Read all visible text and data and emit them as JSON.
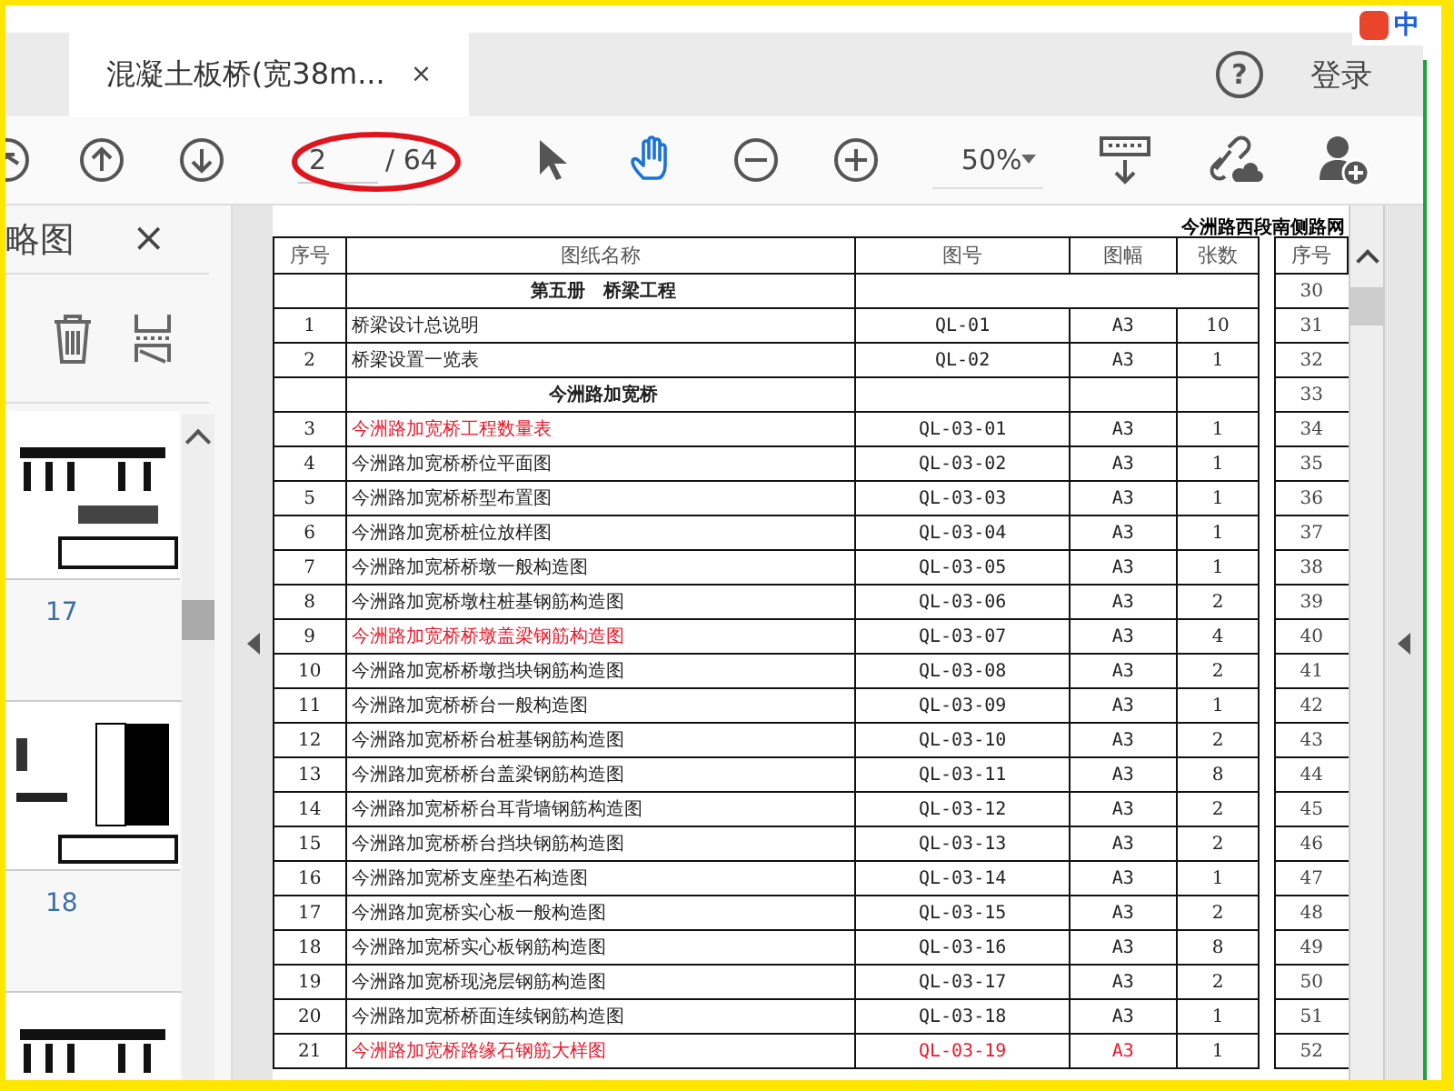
{
  "ime": {
    "label": "中"
  },
  "tab": {
    "title": "混凝土板桥(宽38m...",
    "close": "×"
  },
  "header_actions": {
    "help": "?",
    "login": "登录"
  },
  "toolbar": {
    "page_current": "2",
    "page_total": "/ 64",
    "zoom": "50%",
    "tools": [
      {
        "kind": "select",
        "selected": false
      },
      {
        "kind": "hand",
        "selected": true
      }
    ]
  },
  "thumbnails_panel": {
    "title": "略图",
    "close": "×",
    "pages": [
      {
        "label": "17"
      },
      {
        "label": "18"
      }
    ]
  },
  "document": {
    "page_header": "今洲路西段南侧路网",
    "columns": [
      "序号",
      "图纸名称",
      "图号",
      "图幅",
      "张数"
    ],
    "side_column": "序号",
    "rows": [
      {
        "kind": "volume",
        "title": "第五册　桥梁工程",
        "side": "30"
      },
      {
        "kind": "item",
        "no": "1",
        "name": "桥梁设计总说明",
        "code": "QL-01",
        "size": "A3",
        "sheets": "10",
        "name_flagged": false,
        "code_flagged": false,
        "side": "31"
      },
      {
        "kind": "item",
        "no": "2",
        "name": "桥梁设置一览表",
        "code": "QL-02",
        "size": "A3",
        "sheets": "1",
        "name_flagged": false,
        "code_flagged": false,
        "side": "32"
      },
      {
        "kind": "section",
        "title": "今洲路加宽桥",
        "side": "33"
      },
      {
        "kind": "item",
        "no": "3",
        "name": "今洲路加宽桥工程数量表",
        "code": "QL-03-01",
        "size": "A3",
        "sheets": "1",
        "name_flagged": true,
        "code_flagged": false,
        "side": "34"
      },
      {
        "kind": "item",
        "no": "4",
        "name": "今洲路加宽桥桥位平面图",
        "code": "QL-03-02",
        "size": "A3",
        "sheets": "1",
        "name_flagged": false,
        "code_flagged": false,
        "side": "35"
      },
      {
        "kind": "item",
        "no": "5",
        "name": "今洲路加宽桥桥型布置图",
        "code": "QL-03-03",
        "size": "A3",
        "sheets": "1",
        "name_flagged": false,
        "code_flagged": false,
        "side": "36"
      },
      {
        "kind": "item",
        "no": "6",
        "name": "今洲路加宽桥桩位放样图",
        "code": "QL-03-04",
        "size": "A3",
        "sheets": "1",
        "name_flagged": false,
        "code_flagged": false,
        "side": "37"
      },
      {
        "kind": "item",
        "no": "7",
        "name": "今洲路加宽桥桥墩一般构造图",
        "code": "QL-03-05",
        "size": "A3",
        "sheets": "1",
        "name_flagged": false,
        "code_flagged": false,
        "side": "38"
      },
      {
        "kind": "item",
        "no": "8",
        "name": "今洲路加宽桥墩柱桩基钢筋构造图",
        "code": "QL-03-06",
        "size": "A3",
        "sheets": "2",
        "name_flagged": false,
        "code_flagged": false,
        "side": "39"
      },
      {
        "kind": "item",
        "no": "9",
        "name": "今洲路加宽桥桥墩盖梁钢筋构造图",
        "code": "QL-03-07",
        "size": "A3",
        "sheets": "4",
        "name_flagged": true,
        "code_flagged": false,
        "side": "40"
      },
      {
        "kind": "item",
        "no": "10",
        "name": "今洲路加宽桥桥墩挡块钢筋构造图",
        "code": "QL-03-08",
        "size": "A3",
        "sheets": "2",
        "name_flagged": false,
        "code_flagged": false,
        "side": "41"
      },
      {
        "kind": "item",
        "no": "11",
        "name": "今洲路加宽桥桥台一般构造图",
        "code": "QL-03-09",
        "size": "A3",
        "sheets": "1",
        "name_flagged": false,
        "code_flagged": false,
        "side": "42"
      },
      {
        "kind": "item",
        "no": "12",
        "name": "今洲路加宽桥桥台桩基钢筋构造图",
        "code": "QL-03-10",
        "size": "A3",
        "sheets": "2",
        "name_flagged": false,
        "code_flagged": false,
        "side": "43"
      },
      {
        "kind": "item",
        "no": "13",
        "name": "今洲路加宽桥桥台盖梁钢筋构造图",
        "code": "QL-03-11",
        "size": "A3",
        "sheets": "8",
        "name_flagged": false,
        "code_flagged": false,
        "side": "44"
      },
      {
        "kind": "item",
        "no": "14",
        "name": "今洲路加宽桥桥台耳背墙钢筋构造图",
        "code": "QL-03-12",
        "size": "A3",
        "sheets": "2",
        "name_flagged": false,
        "code_flagged": false,
        "side": "45"
      },
      {
        "kind": "item",
        "no": "15",
        "name": "今洲路加宽桥桥台挡块钢筋构造图",
        "code": "QL-03-13",
        "size": "A3",
        "sheets": "2",
        "name_flagged": false,
        "code_flagged": false,
        "side": "46"
      },
      {
        "kind": "item",
        "no": "16",
        "name": "今洲路加宽桥支座垫石构造图",
        "code": "QL-03-14",
        "size": "A3",
        "sheets": "1",
        "name_flagged": false,
        "code_flagged": false,
        "side": "47"
      },
      {
        "kind": "item",
        "no": "17",
        "name": "今洲路加宽桥实心板一般构造图",
        "code": "QL-03-15",
        "size": "A3",
        "sheets": "2",
        "name_flagged": false,
        "code_flagged": false,
        "side": "48"
      },
      {
        "kind": "item",
        "no": "18",
        "name": "今洲路加宽桥实心板钢筋构造图",
        "code": "QL-03-16",
        "size": "A3",
        "sheets": "8",
        "name_flagged": false,
        "code_flagged": false,
        "side": "49"
      },
      {
        "kind": "item",
        "no": "19",
        "name": "今洲路加宽桥现浇层钢筋构造图",
        "code": "QL-03-17",
        "size": "A3",
        "sheets": "2",
        "name_flagged": false,
        "code_flagged": false,
        "side": "50"
      },
      {
        "kind": "item",
        "no": "20",
        "name": "今洲路加宽桥桥面连续钢筋构造图",
        "code": "QL-03-18",
        "size": "A3",
        "sheets": "1",
        "name_flagged": false,
        "code_flagged": false,
        "side": "51"
      },
      {
        "kind": "item",
        "no": "21",
        "name": "今洲路加宽桥路缘石钢筋大样图",
        "code": "QL-03-19",
        "size": "A3",
        "sheets": "1",
        "name_flagged": true,
        "code_flagged": true,
        "side": "52"
      }
    ]
  }
}
